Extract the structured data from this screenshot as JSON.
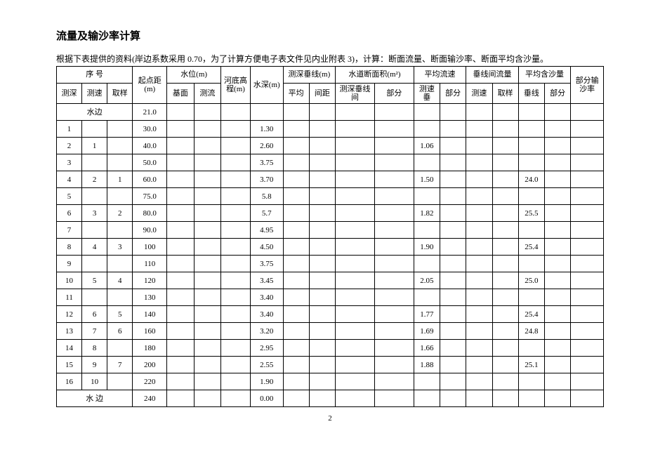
{
  "title": "流量及输沙率计算",
  "description": "根据下表提供的资料(岸边系数采用 0.70，为了计算方便电子表文件见内业附表 3)，计算：断面流量、断面输沙率、断面平均含沙量。",
  "headers": {
    "xuhao": "序    号",
    "ceshen": "测深",
    "cesu": "测速",
    "quyang": "取样",
    "qidianju": "起点距(m)",
    "shuiwei": "水位(m)",
    "jimian": "基面",
    "celiu": "测流",
    "hedigaocheng": "河底高程(m)",
    "shuishen": "水深(m)",
    "ceshenchuixian": "测深垂线(m)",
    "pingjun": "平均",
    "jianju": "间距",
    "shuidaoduanmianji": "水道断面积(m²)",
    "ceshenchuixianjian": "测深垂线间",
    "bufen": "部分",
    "pingjunliusu": "平均流速",
    "cesuchui": "测速垂",
    "chuixianjianliu": "垂线间流量",
    "cesu2": "测速",
    "quyang2": "取样",
    "pingjunhanshaliang": "平均含沙量",
    "chuixian": "垂线",
    "bufenshusha": "部分输沙率"
  },
  "shuibian_top": "水边",
  "shuibian_bottom": "水    边",
  "rows": [
    {
      "ceshen": "",
      "cesu": "",
      "quyang": "",
      "qdj": "21.0",
      "ss": ""
    },
    {
      "ceshen": "1",
      "cesu": "",
      "quyang": "",
      "qdj": "30.0",
      "ss": "1.30",
      "pjls": "",
      "hsl": ""
    },
    {
      "ceshen": "2",
      "cesu": "1",
      "quyang": "",
      "qdj": "40.0",
      "ss": "2.60",
      "pjls": "1.06",
      "hsl": ""
    },
    {
      "ceshen": "3",
      "cesu": "",
      "quyang": "",
      "qdj": "50.0",
      "ss": "3.75",
      "pjls": "",
      "hsl": ""
    },
    {
      "ceshen": "4",
      "cesu": "2",
      "quyang": "1",
      "qdj": "60.0",
      "ss": "3.70",
      "pjls": "1.50",
      "hsl": "24.0"
    },
    {
      "ceshen": "5",
      "cesu": "",
      "quyang": "",
      "qdj": "75.0",
      "ss": "5.8",
      "pjls": "",
      "hsl": ""
    },
    {
      "ceshen": "6",
      "cesu": "3",
      "quyang": "2",
      "qdj": "80.0",
      "ss": "5.7",
      "pjls": "1.82",
      "hsl": "25.5"
    },
    {
      "ceshen": "7",
      "cesu": "",
      "quyang": "",
      "qdj": "90.0",
      "ss": "4.95",
      "pjls": "",
      "hsl": ""
    },
    {
      "ceshen": "8",
      "cesu": "4",
      "quyang": "3",
      "qdj": "100",
      "ss": "4.50",
      "pjls": "1.90",
      "hsl": "25.4"
    },
    {
      "ceshen": "9",
      "cesu": "",
      "quyang": "",
      "qdj": "110",
      "ss": "3.75",
      "pjls": "",
      "hsl": ""
    },
    {
      "ceshen": "10",
      "cesu": "5",
      "quyang": "4",
      "qdj": "120",
      "ss": "3.45",
      "pjls": "2.05",
      "hsl": "25.0"
    },
    {
      "ceshen": "11",
      "cesu": "",
      "quyang": "",
      "qdj": "130",
      "ss": "3.40",
      "pjls": "",
      "hsl": ""
    },
    {
      "ceshen": "12",
      "cesu": "6",
      "quyang": "5",
      "qdj": "140",
      "ss": "3.40",
      "pjls": "1.77",
      "hsl": "25.4"
    },
    {
      "ceshen": "13",
      "cesu": "7",
      "quyang": "6",
      "qdj": "160",
      "ss": "3.20",
      "pjls": "1.69",
      "hsl": "24.8"
    },
    {
      "ceshen": "14",
      "cesu": "8",
      "quyang": "",
      "qdj": "180",
      "ss": "2.95",
      "pjls": "1.66",
      "hsl": ""
    },
    {
      "ceshen": "15",
      "cesu": "9",
      "quyang": "7",
      "qdj": "200",
      "ss": "2.55",
      "pjls": "1.88",
      "hsl": "25.1"
    },
    {
      "ceshen": "16",
      "cesu": "10",
      "quyang": "",
      "qdj": "220",
      "ss": "1.90",
      "pjls": "",
      "hsl": ""
    },
    {
      "ceshen": "",
      "cesu": "",
      "quyang": "",
      "qdj": "240",
      "ss": "0.00",
      "pjls": "",
      "hsl": ""
    }
  ],
  "pageNumber": "2"
}
